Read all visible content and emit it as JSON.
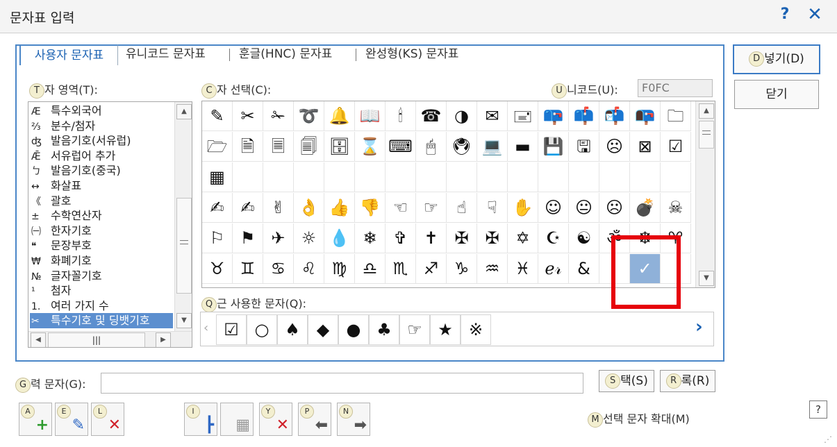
{
  "window": {
    "title": "문자표 입력",
    "help": "?",
    "close": "✕"
  },
  "tabs": [
    {
      "label": "사용자 문자표",
      "active": true
    },
    {
      "label": "유니코드 문자표",
      "active": false
    },
    {
      "label": "훈글(HNC) 문자표",
      "active": false
    },
    {
      "label": "완성형(KS) 문자표",
      "active": false
    }
  ],
  "labels": {
    "area": "자 영역(T):",
    "area_hint": "T",
    "select": "자 선택(C):",
    "select_hint": "C",
    "unicode": "니코드(U):",
    "unicode_hint": "U",
    "recent": "근 사용한 문자(Q):",
    "recent_hint": "Q",
    "input": "력 문자(G):",
    "input_hint": "G",
    "enlarge": "선택 문자 확대(M)",
    "enlarge_hint": "M"
  },
  "unicode_value": "F0FC",
  "area_items": [
    {
      "icon": "Æ",
      "label": "특수외국어"
    },
    {
      "icon": "⅔",
      "label": "분수/첨자"
    },
    {
      "icon": "ʤ",
      "label": "발음기호(서유럽)"
    },
    {
      "icon": "Ǣ",
      "label": "서유럽어 추가"
    },
    {
      "icon": "ㄅ",
      "label": "발음기호(중국)"
    },
    {
      "icon": "↔",
      "label": "화살표"
    },
    {
      "icon": "《",
      "label": "괄호"
    },
    {
      "icon": "±",
      "label": "수학연산자"
    },
    {
      "icon": "㈠",
      "label": "한자기호"
    },
    {
      "icon": "❝",
      "label": "문장부호"
    },
    {
      "icon": "₩",
      "label": "화폐기호"
    },
    {
      "icon": "№",
      "label": "글자꼴기호"
    },
    {
      "icon": "¹",
      "label": "첨자"
    },
    {
      "icon": "1.",
      "label": "여러 가지 수"
    },
    {
      "icon": "✂",
      "label": "특수기호 및 딩뱃기호",
      "selected": true
    }
  ],
  "char_rows": [
    [
      "✎",
      "✂",
      "✁",
      "➰",
      "🔔",
      "📖",
      "🕯",
      "☎",
      "◑",
      "✉",
      "🖃",
      "📪",
      "📫",
      "📬",
      "📭",
      "🗀"
    ],
    [
      "🗁",
      "🗎",
      "🗏",
      "🗐",
      "🗄",
      "⌛",
      "⌨",
      "🖱",
      "🖲",
      "💻",
      "▬",
      "💾",
      "🖫",
      "☹",
      "⊠",
      "☑"
    ],
    [
      "▦",
      "",
      "",
      "",
      "",
      "",
      "",
      "",
      "",
      "",
      "",
      "",
      "",
      "",
      "",
      ""
    ],
    [
      "✍",
      "✍",
      "✌",
      "👌",
      "👍",
      "👎",
      "☜",
      "☞",
      "☝",
      "☟",
      "✋",
      "☺",
      "😐",
      "☹",
      "💣",
      "☠"
    ],
    [
      "⚐",
      "⚑",
      "✈",
      "☼",
      "💧",
      "❄",
      "✞",
      "✝",
      "✠",
      "✠",
      "✡",
      "☪",
      "☯",
      "ॐ",
      "☸",
      "♈"
    ],
    [
      "♉",
      "♊",
      "♋",
      "♌",
      "♍",
      "♎",
      "♏",
      "♐",
      "♑",
      "♒",
      "♓",
      "ℯ𝓇",
      "&",
      "",
      "✓",
      ""
    ]
  ],
  "selected_char": "✓",
  "recent_chars": [
    "☑",
    "○",
    "♠",
    "◆",
    "●",
    "♣",
    "☞",
    "★",
    "※"
  ],
  "buttons": {
    "insert": "넣기(D)",
    "insert_hint": "D",
    "close": "닫기",
    "select": "택(S)",
    "select_hint": "S",
    "register": "록(R)",
    "register_hint": "R"
  },
  "toolbar": [
    {
      "hint": "A",
      "glyph": "+",
      "color": "#2e9b2e"
    },
    {
      "hint": "E",
      "glyph": "✎",
      "color": "#2f68c4"
    },
    {
      "hint": "L",
      "glyph": "✕",
      "color": "#d0202a"
    },
    {
      "hint": "I",
      "glyph": "┣",
      "color": "#2f68c4"
    },
    {
      "hint": "",
      "glyph": "▦",
      "color": "#9a9a9a"
    },
    {
      "hint": "Y",
      "glyph": "✕",
      "color": "#d0202a"
    },
    {
      "hint": "P",
      "glyph": "⬅",
      "color": "#555555"
    },
    {
      "hint": "N",
      "glyph": "➡",
      "color": "#555555"
    }
  ],
  "help_small": "?"
}
